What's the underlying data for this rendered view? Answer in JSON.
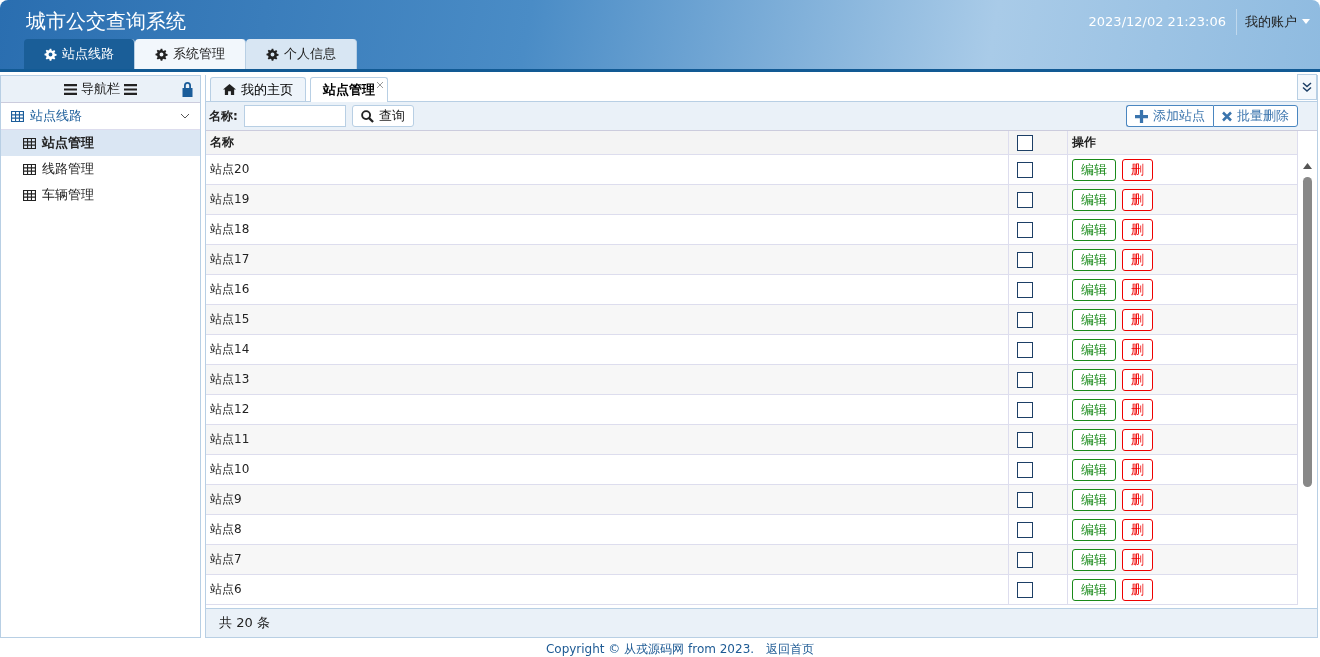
{
  "header": {
    "title": "城市公交查询系统",
    "datetime": "2023/12/02 21:23:06",
    "account": "我的账户",
    "tabs": [
      {
        "label": "站点线路",
        "selected": true
      },
      {
        "label": "系统管理",
        "selected": false
      },
      {
        "label": "个人信息",
        "selected": false
      }
    ]
  },
  "sidebar": {
    "title": "导航栏",
    "group": {
      "label": "站点线路",
      "expanded": true,
      "items": [
        {
          "label": "站点管理",
          "selected": true
        },
        {
          "label": "线路管理",
          "selected": false
        },
        {
          "label": "车辆管理",
          "selected": false
        }
      ]
    }
  },
  "content": {
    "tabs": [
      {
        "label": "我的主页",
        "kind": "home",
        "selected": false,
        "closable": false
      },
      {
        "label": "站点管理",
        "kind": "page",
        "selected": true,
        "closable": true
      }
    ],
    "search": {
      "label": "名称:",
      "button": "查询"
    },
    "actions": [
      {
        "label": "添加站点",
        "kind": "add"
      },
      {
        "label": "批量删除",
        "kind": "remove"
      }
    ],
    "table": {
      "columns": [
        "名称",
        "操作"
      ],
      "all_checked": false,
      "rows": [
        {
          "name": "站点20",
          "checked": false,
          "edit": "编辑",
          "delete": "删"
        },
        {
          "name": "站点19",
          "checked": false,
          "edit": "编辑",
          "delete": "删"
        },
        {
          "name": "站点18",
          "checked": false,
          "edit": "编辑",
          "delete": "删"
        },
        {
          "name": "站点17",
          "checked": false,
          "edit": "编辑",
          "delete": "删"
        },
        {
          "name": "站点16",
          "checked": false,
          "edit": "编辑",
          "delete": "删"
        },
        {
          "name": "站点15",
          "checked": false,
          "edit": "编辑",
          "delete": "删"
        },
        {
          "name": "站点14",
          "checked": false,
          "edit": "编辑",
          "delete": "删"
        },
        {
          "name": "站点13",
          "checked": false,
          "edit": "编辑",
          "delete": "删"
        },
        {
          "name": "站点12",
          "checked": false,
          "edit": "编辑",
          "delete": "删"
        },
        {
          "name": "站点11",
          "checked": false,
          "edit": "编辑",
          "delete": "删"
        },
        {
          "name": "站点10",
          "checked": false,
          "edit": "编辑",
          "delete": "删"
        },
        {
          "name": "站点9",
          "checked": false,
          "edit": "编辑",
          "delete": "删"
        },
        {
          "name": "站点8",
          "checked": false,
          "edit": "编辑",
          "delete": "删"
        },
        {
          "name": "站点7",
          "checked": false,
          "edit": "编辑",
          "delete": "删"
        },
        {
          "name": "站点6",
          "checked": false,
          "edit": "编辑",
          "delete": "删"
        }
      ]
    },
    "total": "共 20 条"
  },
  "footer": {
    "copyright": "Copyright © 从戎源码网 from 2023.",
    "link": "返回首页"
  }
}
